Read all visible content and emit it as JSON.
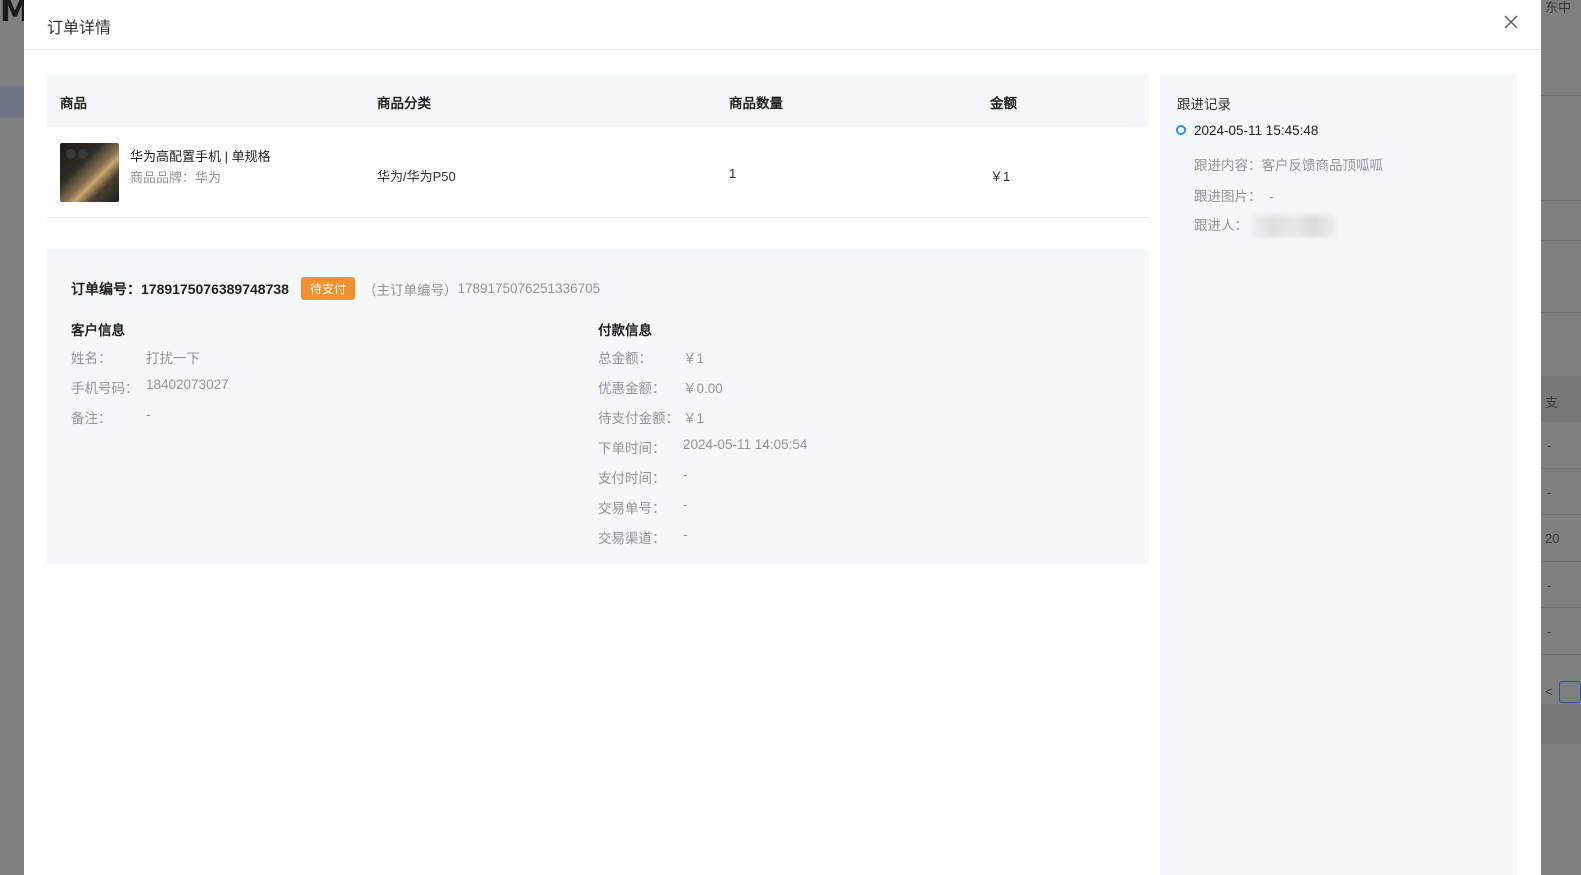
{
  "background": {
    "logo_text": "M",
    "right_texts": [
      "东中",
      "支",
      "-",
      "-",
      "20",
      "-",
      "-",
      "<"
    ]
  },
  "dialog": {
    "title": "订单详情",
    "close_icon": "close-icon"
  },
  "product_table": {
    "headers": [
      "商品",
      "商品分类",
      "商品数量",
      "金额"
    ],
    "rows": [
      {
        "name": "华为高配置手机 | 单规格",
        "brand_label": "商品品牌：华为",
        "category": "华为/华为P50",
        "quantity": "1",
        "amount": "￥1"
      }
    ]
  },
  "order": {
    "number_label": "订单编号：",
    "number": "1789175076389748738",
    "status_badge": "待支付",
    "status_color": "#f0922b",
    "main_order_label": "（主订单编号）",
    "main_order_number": "1789175076251336705"
  },
  "customer_info": {
    "title": "客户信息",
    "fields": [
      {
        "label": "姓名：",
        "value": "打扰一下"
      },
      {
        "label": "手机号码：",
        "value": "18402073027"
      },
      {
        "label": "备注：",
        "value": "-"
      }
    ]
  },
  "payment_info": {
    "title": "付款信息",
    "fields": [
      {
        "label": "总金额：",
        "value": "￥1"
      },
      {
        "label": "优惠金额：",
        "value": "￥0.00"
      },
      {
        "label": "待支付金额：",
        "value": "￥1"
      },
      {
        "label": "下单时间：",
        "value": "2024-05-11 14:05:54"
      },
      {
        "label": "支付时间：",
        "value": "-"
      },
      {
        "label": "交易单号：",
        "value": "-"
      },
      {
        "label": "交易渠道：",
        "value": "-"
      }
    ]
  },
  "follow_up": {
    "title": "跟进记录",
    "entries": [
      {
        "time": "2024-05-11 15:45:48",
        "content_label": "跟进内容：",
        "content": "客户反馈商品顶呱呱",
        "image_label": "跟进图片：",
        "image_value": "-",
        "person_label": "跟进人："
      }
    ],
    "accent_color": "#2d8cf0"
  }
}
